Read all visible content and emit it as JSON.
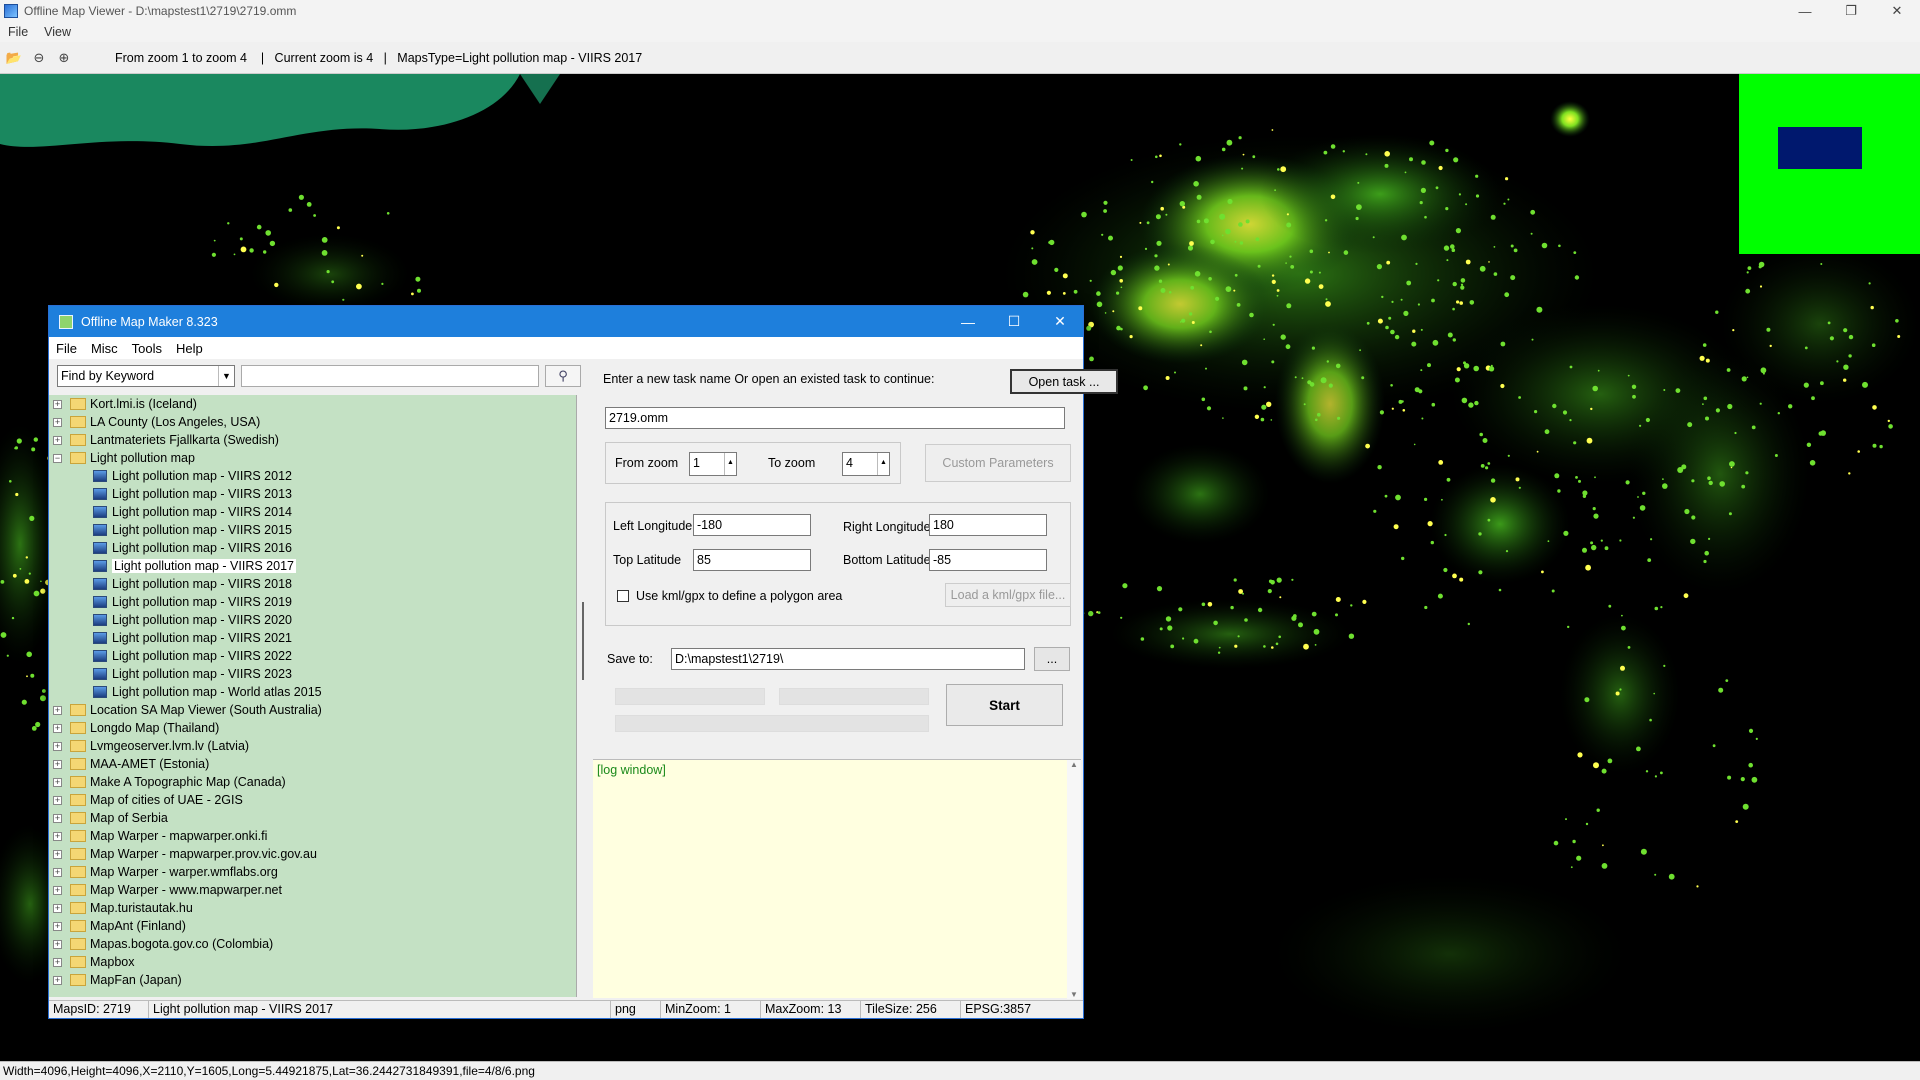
{
  "viewer": {
    "title": "Offline Map Viewer - D:\\mapstest1\\2719\\2719.omm",
    "menu": [
      "File",
      "View"
    ],
    "toolbar_info": "From zoom 1 to zoom 4    |   Current zoom is 4   |   MapsType=Light pollution map - VIIRS 2017",
    "status": "Width=4096,Height=4096,X=2110,Y=1605,Long=5.44921875,Lat=36.2442731849391,file=4/8/6.png"
  },
  "dialog": {
    "title": "Offline Map Maker 8.323",
    "menu": [
      "File",
      "Misc",
      "Tools",
      "Help"
    ],
    "search": {
      "mode": "Find by Keyword",
      "keyword": ""
    },
    "tree": [
      {
        "label": "Kort.lmi.is (Iceland)",
        "type": "folder"
      },
      {
        "label": "LA County (Los Angeles, USA)",
        "type": "folder"
      },
      {
        "label": "Lantmateriets Fjallkarta (Swedish)",
        "type": "folder"
      },
      {
        "label": "Light pollution map",
        "type": "open"
      },
      {
        "label": "Light pollution map - VIIRS 2012",
        "type": "leaf"
      },
      {
        "label": "Light pollution map - VIIRS 2013",
        "type": "leaf"
      },
      {
        "label": "Light pollution map - VIIRS 2014",
        "type": "leaf"
      },
      {
        "label": "Light pollution map - VIIRS 2015",
        "type": "leaf"
      },
      {
        "label": "Light pollution map - VIIRS 2016",
        "type": "leaf"
      },
      {
        "label": "Light pollution map - VIIRS 2017",
        "type": "leaf",
        "selected": true
      },
      {
        "label": "Light pollution map - VIIRS 2018",
        "type": "leaf"
      },
      {
        "label": "Light pollution map - VIIRS 2019",
        "type": "leaf"
      },
      {
        "label": "Light pollution map - VIIRS 2020",
        "type": "leaf"
      },
      {
        "label": "Light pollution map - VIIRS 2021",
        "type": "leaf"
      },
      {
        "label": "Light pollution map - VIIRS 2022",
        "type": "leaf"
      },
      {
        "label": "Light pollution map - VIIRS 2023",
        "type": "leaf"
      },
      {
        "label": "Light pollution map - World atlas 2015",
        "type": "leaf"
      },
      {
        "label": "Location SA Map Viewer (South Australia)",
        "type": "folder"
      },
      {
        "label": "Longdo Map (Thailand)",
        "type": "folder"
      },
      {
        "label": "Lvmgeoserver.lvm.lv (Latvia)",
        "type": "folder"
      },
      {
        "label": "MAA-AMET (Estonia)",
        "type": "folder"
      },
      {
        "label": "Make A Topographic Map (Canada)",
        "type": "folder"
      },
      {
        "label": "Map of cities of UAE - 2GIS",
        "type": "folder"
      },
      {
        "label": "Map of Serbia",
        "type": "folder"
      },
      {
        "label": "Map Warper - mapwarper.onki.fi",
        "type": "folder"
      },
      {
        "label": "Map Warper - mapwarper.prov.vic.gov.au",
        "type": "folder"
      },
      {
        "label": "Map Warper - warper.wmflabs.org",
        "type": "folder"
      },
      {
        "label": "Map Warper - www.mapwarper.net",
        "type": "folder"
      },
      {
        "label": "Map.turistautak.hu",
        "type": "folder"
      },
      {
        "label": "MapAnt (Finland)",
        "type": "folder"
      },
      {
        "label": "Mapas.bogota.gov.co (Colombia)",
        "type": "folder"
      },
      {
        "label": "Mapbox",
        "type": "folder"
      },
      {
        "label": "MapFan (Japan)",
        "type": "folder"
      }
    ],
    "task": {
      "prompt": "Enter a new task name Or open an existed task to continue:",
      "open_label": "Open task ...",
      "name": "2719.omm",
      "from_zoom_label": "From zoom",
      "from_zoom": "1",
      "to_zoom_label": "To zoom",
      "to_zoom": "4",
      "custom_label": "Custom Parameters",
      "left_lon_label": "Left Longitude",
      "left_lon": "-180",
      "right_lon_label": "Right Longitude",
      "right_lon": "180",
      "top_lat_label": "Top Latitude",
      "top_lat": "85",
      "bottom_lat_label": "Bottom Latitude",
      "bottom_lat": "-85",
      "kml_label": "Use kml/gpx to define a polygon area",
      "kml_btn": "Load a kml/gpx file...",
      "save_label": "Save to:",
      "save_path": "D:\\mapstest1\\2719\\",
      "browse": "...",
      "start": "Start"
    },
    "log": "[log window]",
    "status": {
      "mapsid": "MapsID: 2719",
      "name": "Light pollution map - VIIRS 2017",
      "format": "png",
      "minzoom": "MinZoom: 1",
      "maxzoom": "MaxZoom: 13",
      "tilesize": "TileSize: 256",
      "epsg": "EPSG:3857"
    }
  }
}
